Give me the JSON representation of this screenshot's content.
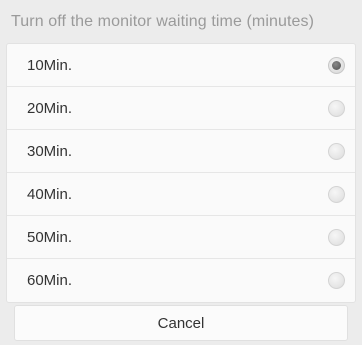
{
  "dialog": {
    "title": "Turn off the monitor waiting time (minutes)",
    "options": [
      {
        "label": "10Min.",
        "selected": true
      },
      {
        "label": "20Min.",
        "selected": false
      },
      {
        "label": "30Min.",
        "selected": false
      },
      {
        "label": "40Min.",
        "selected": false
      },
      {
        "label": "50Min.",
        "selected": false
      },
      {
        "label": "60Min.",
        "selected": false
      }
    ],
    "cancel_label": "Cancel"
  }
}
